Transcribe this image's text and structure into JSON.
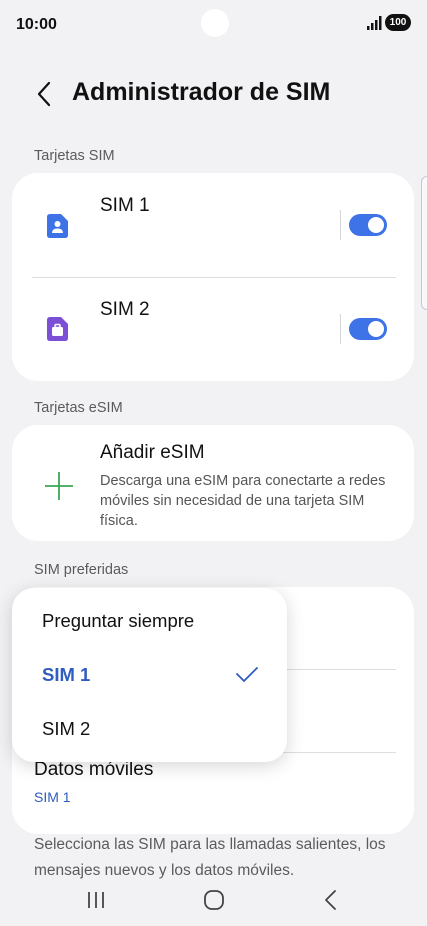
{
  "status_bar": {
    "time": "10:00",
    "battery": "100"
  },
  "header": {
    "title": "Administrador de SIM"
  },
  "sim_cards": {
    "label": "Tarjetas SIM",
    "items": [
      {
        "name": "SIM 1",
        "enabled": true,
        "icon": "sim-person-icon",
        "color": "#3e73e8"
      },
      {
        "name": "SIM 2",
        "enabled": true,
        "icon": "sim-briefcase-icon",
        "color": "#7b4fd6"
      }
    ]
  },
  "esim": {
    "label": "Tarjetas eSIM",
    "add_title": "Añadir eSIM",
    "add_description": "Descarga una eSIM para conectarte a redes móviles sin necesidad de una tarjeta SIM física."
  },
  "preferred": {
    "label": "SIM preferidas",
    "mobile_data_label": "Datos móviles",
    "mobile_data_value": "SIM 1"
  },
  "dropdown": {
    "options": [
      "Preguntar siempre",
      "SIM 1",
      "SIM 2"
    ],
    "selected": "SIM 1"
  },
  "footer": {
    "text": "Selecciona las SIM para las llamadas salientes, los mensajes nuevos y los datos móviles."
  },
  "colors": {
    "accent": "#3e73e8",
    "selected_text": "#2f5cc0",
    "add_icon": "#3aa655"
  }
}
